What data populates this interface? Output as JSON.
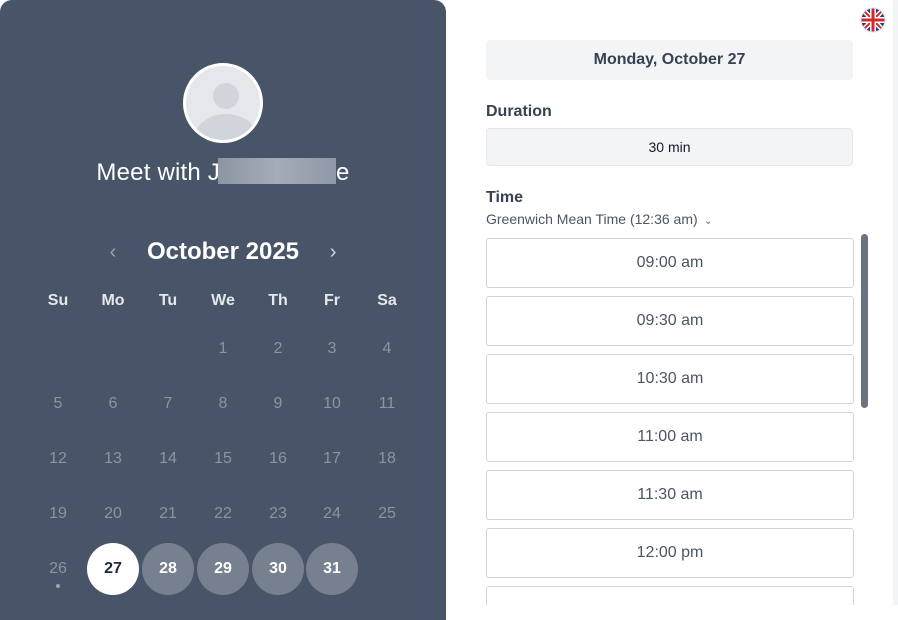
{
  "left": {
    "title_prefix": "Meet with J",
    "title_suffix": "e",
    "month_label": "October 2025",
    "prev_icon": "chevron-left-icon",
    "next_icon": "chevron-right-icon",
    "weekdays": [
      "Su",
      "Mo",
      "Tu",
      "We",
      "Th",
      "Fr",
      "Sa"
    ],
    "days": [
      "1",
      "2",
      "3",
      "4",
      "5",
      "6",
      "7",
      "8",
      "9",
      "10",
      "11",
      "12",
      "13",
      "14",
      "15",
      "16",
      "17",
      "18",
      "19",
      "20",
      "21",
      "22",
      "23",
      "24",
      "25",
      "26",
      "27",
      "28",
      "29",
      "30",
      "31"
    ],
    "selected_day": "27",
    "available_days": [
      "28",
      "29",
      "30",
      "31"
    ],
    "today": "26"
  },
  "right": {
    "language_icon": "uk-flag-icon",
    "selected_date": "Monday, October 27",
    "duration_label": "Duration",
    "duration_value": "30 min",
    "time_label": "Time",
    "timezone": "Greenwich Mean Time (12:36 am)",
    "timezone_icon": "chevron-down-icon",
    "slots": [
      "09:00 am",
      "09:30 am",
      "10:30 am",
      "11:00 am",
      "11:30 am",
      "12:00 pm"
    ]
  },
  "colors": {
    "panel": "#485568",
    "available_day": "#76808e",
    "selected_day": "#ffffff"
  }
}
